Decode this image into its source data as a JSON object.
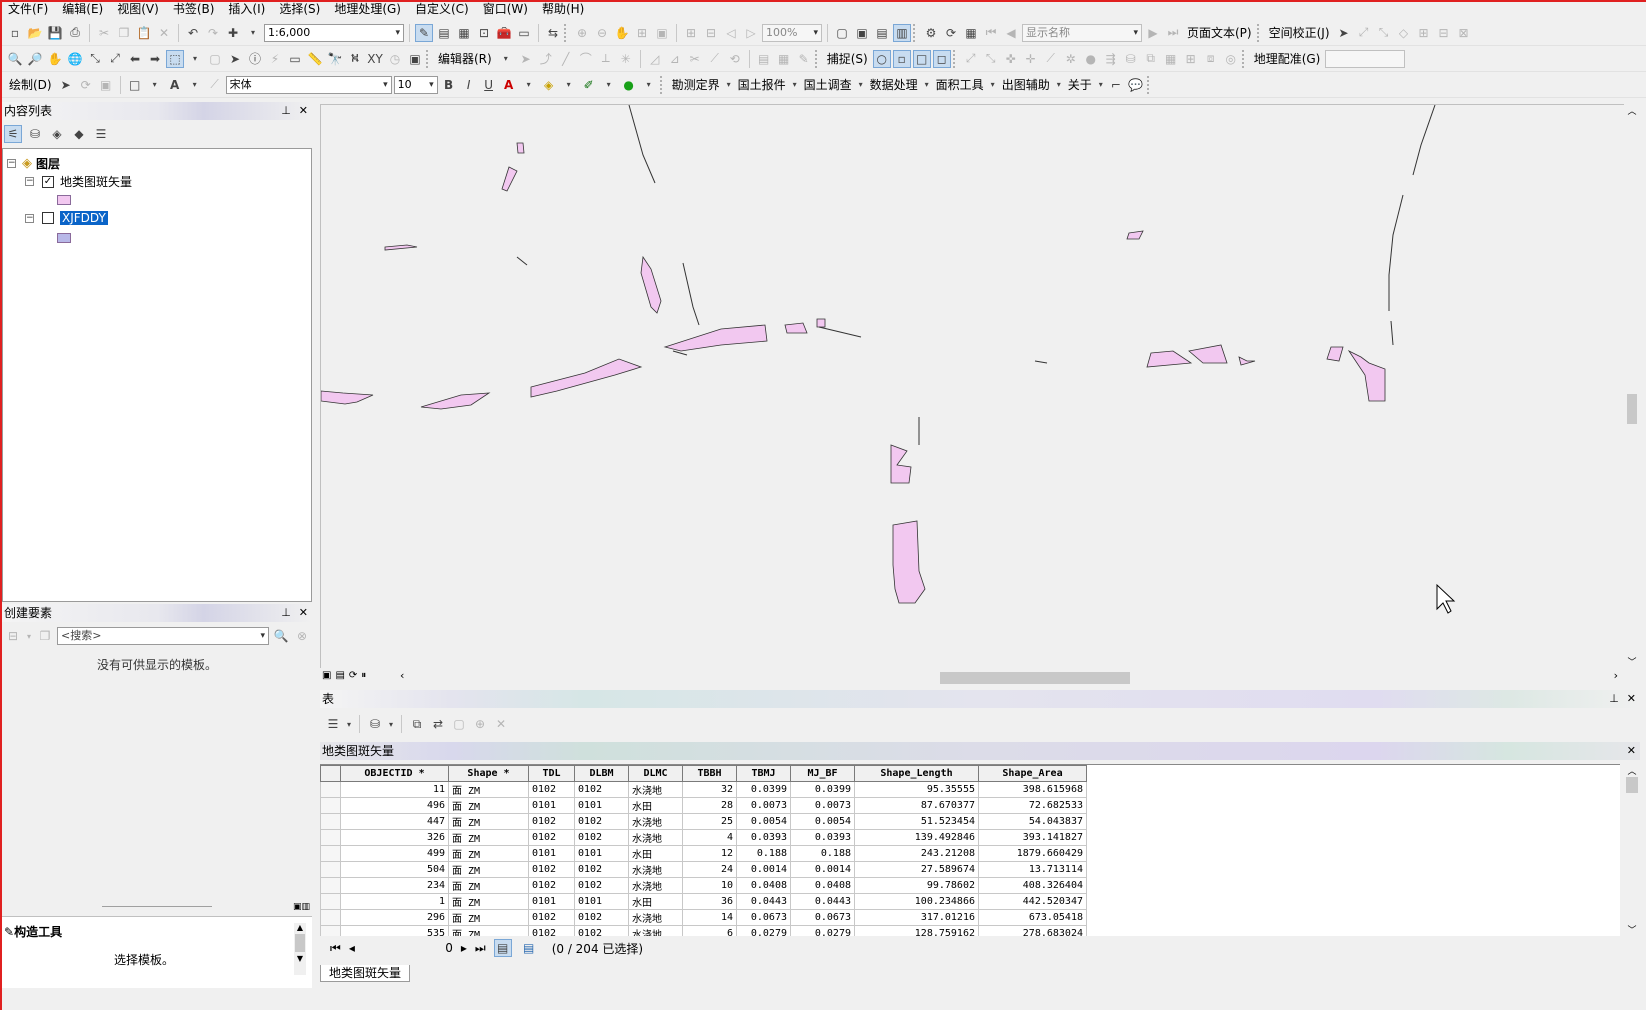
{
  "menu": [
    "文件(F)",
    "编辑(E)",
    "视图(V)",
    "书签(B)",
    "插入(I)",
    "选择(S)",
    "地理处理(G)",
    "自定义(C)",
    "窗口(W)",
    "帮助(H)"
  ],
  "toolbar1": {
    "scale": "1:6,000",
    "zoom": "100%",
    "display_name": "显示名称",
    "page_text": "页面文本(P)",
    "spatial_adjust": "空间校正(J)"
  },
  "toolbar2": {
    "editor": "编辑器(R)",
    "snap": "捕捉(S)",
    "georef": "地理配准(G)"
  },
  "toolbar3": {
    "draw": "绘制(D)",
    "font": "宋体",
    "font_size": "10",
    "bold": "B",
    "italic": "I",
    "underline": "U",
    "menus": [
      "勘测定界",
      "国土报件",
      "国土调查",
      "数据处理",
      "面积工具",
      "出图辅助",
      "关于"
    ]
  },
  "toc": {
    "title": "内容列表",
    "root": "图层",
    "layer1": "地类图斑矢量",
    "layer2": "XJFDDY",
    "swatch1": "#f2c8f0",
    "swatch2": "#b8b8e8"
  },
  "create_features": {
    "title": "创建要素",
    "search_placeholder": "<搜索>",
    "empty_msg": "没有可供显示的模板。"
  },
  "construct": {
    "title": "构造工具",
    "msg": "选择模板。"
  },
  "table_win": {
    "title": "表",
    "layer_title": "地类图斑矢量",
    "columns": [
      "OBJECTID *",
      "Shape *",
      "TDL",
      "DLBM",
      "DLMC",
      "TBBH",
      "TBMJ",
      "MJ_BF",
      "Shape_Length",
      "Shape_Area"
    ],
    "rows": [
      [
        "11",
        "面 ZM",
        "0102",
        "0102",
        "水浇地",
        "32",
        "0.0399",
        "0.0399",
        "95.35555",
        "398.615968"
      ],
      [
        "496",
        "面 ZM",
        "0101",
        "0101",
        "水田",
        "28",
        "0.0073",
        "0.0073",
        "87.670377",
        "72.682533"
      ],
      [
        "447",
        "面 ZM",
        "0102",
        "0102",
        "水浇地",
        "25",
        "0.0054",
        "0.0054",
        "51.523454",
        "54.043837"
      ],
      [
        "326",
        "面 ZM",
        "0102",
        "0102",
        "水浇地",
        "4",
        "0.0393",
        "0.0393",
        "139.492846",
        "393.141827"
      ],
      [
        "499",
        "面 ZM",
        "0101",
        "0101",
        "水田",
        "12",
        "0.188",
        "0.188",
        "243.21208",
        "1879.660429"
      ],
      [
        "504",
        "面 ZM",
        "0102",
        "0102",
        "水浇地",
        "24",
        "0.0014",
        "0.0014",
        "27.589674",
        "13.713114"
      ],
      [
        "234",
        "面 ZM",
        "0102",
        "0102",
        "水浇地",
        "10",
        "0.0408",
        "0.0408",
        "99.78602",
        "408.326404"
      ],
      [
        "1",
        "面 ZM",
        "0101",
        "0101",
        "水田",
        "36",
        "0.0443",
        "0.0443",
        "100.234866",
        "442.520347"
      ],
      [
        "296",
        "面 ZM",
        "0102",
        "0102",
        "水浇地",
        "14",
        "0.0673",
        "0.0673",
        "317.01216",
        "673.05418"
      ],
      [
        "535",
        "面 ZM",
        "0102",
        "0102",
        "水浇地",
        "6",
        "0.0279",
        "0.0279",
        "128.759162",
        "278.683024"
      ]
    ],
    "record_index": "0",
    "selection_status": "(0 / 204 已选择)",
    "tab_label": "地类图斑矢量"
  },
  "colors": {
    "polygon_fill": "#f2c8f0",
    "polygon_stroke": "#333333",
    "selection_highlight": "#0a64c8"
  }
}
